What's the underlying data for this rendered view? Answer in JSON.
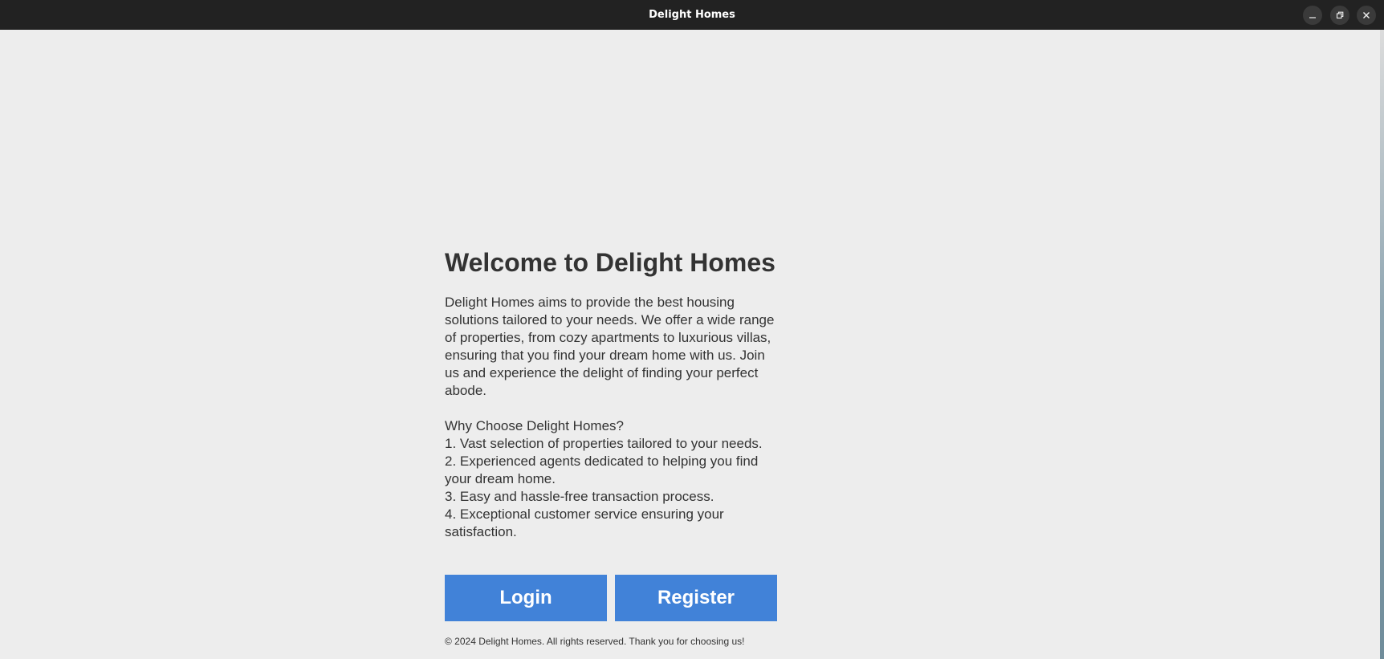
{
  "window": {
    "title": "Delight Homes",
    "controls": {
      "minimize_icon": "minimize-icon",
      "maximize_icon": "restore-icon",
      "close_icon": "close-icon"
    }
  },
  "main": {
    "heading": "Welcome to Delight Homes",
    "intro": "Delight Homes aims to provide the best housing solutions tailored to your needs. We offer a wide range of properties, from cozy apartments to luxurious villas, ensuring that you find your dream home with us. Join us and experience the delight of finding your perfect abode.",
    "why_heading": "Why Choose Delight Homes?",
    "reasons": [
      "1. Vast selection of properties tailored to your needs.",
      "2. Experienced agents dedicated to helping you find your dream home.",
      "3. Easy and hassle-free transaction process.",
      "4. Exceptional customer service ensuring your satisfaction."
    ]
  },
  "actions": {
    "login_label": "Login",
    "register_label": "Register"
  },
  "footer": {
    "text": "© 2024 Delight Homes. All rights reserved. Thank you for choosing us!"
  },
  "colors": {
    "background": "#ededed",
    "titlebar": "#222222",
    "text": "#333333",
    "button": "#4182d8",
    "button_text": "#ffffff"
  }
}
